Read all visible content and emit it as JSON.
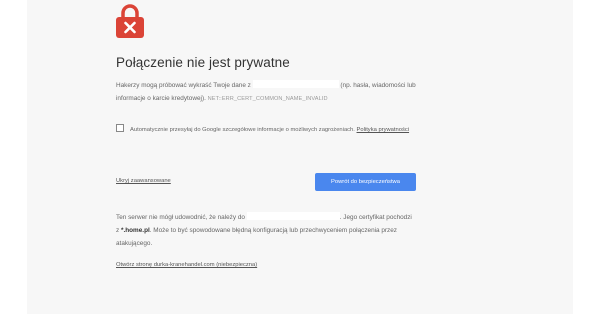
{
  "page": {
    "title": "Połączenie nie jest prywatne",
    "description": {
      "before": "Hakerzy mogą próbować wykraść Twoje dane z ",
      "after": " (np. hasła, wiadomości lub informacje o karcie kredytowej).",
      "error_code": "NET::ERR_CERT_COMMON_NAME_INVALID"
    },
    "checkbox": {
      "label": "Automatycznie przesyłaj do Google szczegółowe informacje o możliwych zagrożeniach.",
      "link": "Polityka prywatności"
    },
    "advanced_link": "Ukryj zaawansowane",
    "back_button": "Powrót do bezpieczeństwa",
    "details": {
      "before": "Ten serwer nie mógł udowodnić, że należy do ",
      "after": ". Jego certyfikat pochodzi z ",
      "cert_domain": "*.home.pl",
      "rest": ". Może to być spowodowane błędną konfiguracją lub przechwyceniem połączenia przez atakującego."
    },
    "proceed_link": "Otwórz stronę durka-kranehandel.com (niebezpieczna)"
  },
  "colors": {
    "panel": "#f7f7f7",
    "lock": "#db4437",
    "button": "#4a87ee"
  },
  "icons": {
    "lock": "padlock-x-icon"
  }
}
